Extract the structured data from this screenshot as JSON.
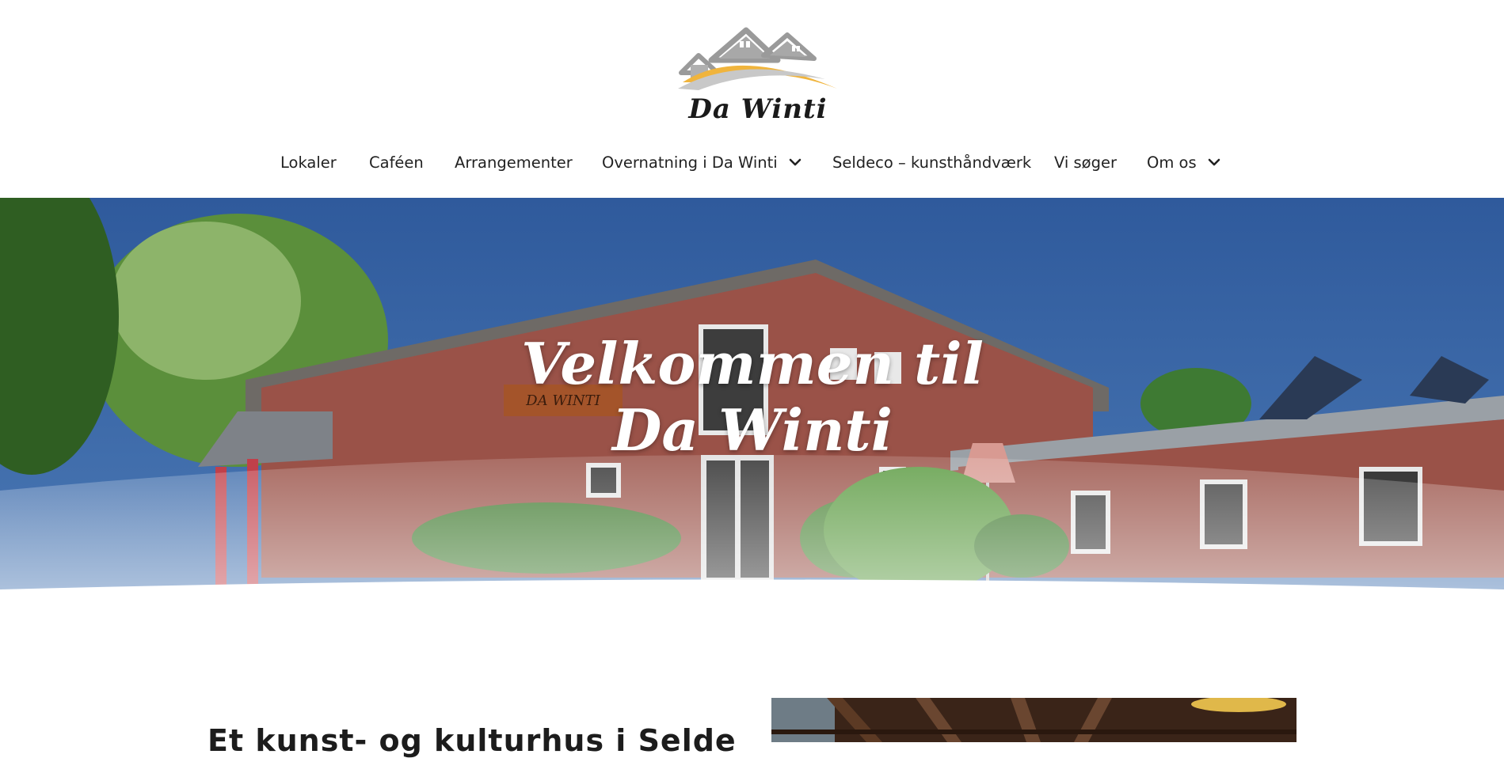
{
  "site": {
    "logo_text": "Da Winti"
  },
  "nav": {
    "items": [
      {
        "label": "Lokaler",
        "has_dropdown": false
      },
      {
        "label": "Caféen",
        "has_dropdown": false
      },
      {
        "label": "Arrangementer",
        "has_dropdown": false
      },
      {
        "label": "Overnatning i Da Winti",
        "has_dropdown": true
      },
      {
        "label": "Seldeco – kunsthåndværk",
        "has_dropdown": false
      },
      {
        "label": "Vi søger",
        "has_dropdown": false
      },
      {
        "label": "Om os",
        "has_dropdown": true
      }
    ]
  },
  "hero": {
    "title_line1": "Velkommen til",
    "title_line2": "Da Winti",
    "sign_text": "DA WINTI"
  },
  "content": {
    "heading": "Et kunst- og kulturhus i Selde"
  },
  "colors": {
    "accent_yellow": "#f0b43c",
    "logo_gray": "#9a9a9a",
    "sky": "#3a65a4",
    "brick": "#9a5248",
    "text": "#1f1f1f"
  }
}
